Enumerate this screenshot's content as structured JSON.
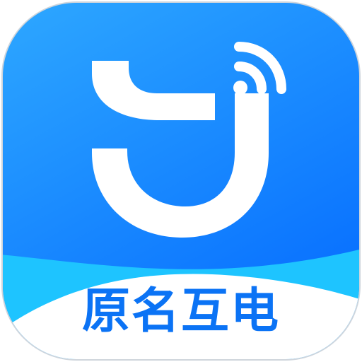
{
  "app_icon": {
    "icon_name": "signal-hook-logo-icon",
    "caption": "原名互电",
    "colors": {
      "background_top": "#29a6ff",
      "background_bottom": "#0a73ff",
      "wave_light": "#1ec4ff",
      "footer": "#ffffff",
      "glyph": "#ffffff",
      "caption_text": "#0b73f5",
      "border": "#cfd5dc"
    }
  }
}
